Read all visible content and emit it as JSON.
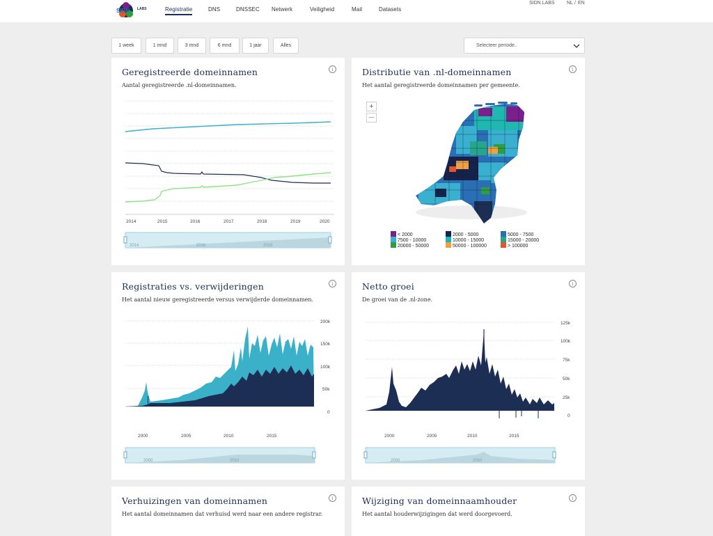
{
  "header": {
    "logo_text": "SIDN",
    "logo_sub": "LABS",
    "nav": [
      "Registratie",
      "DNS",
      "DNSSEC",
      "Netwerk",
      "Veiligheid",
      "Mail",
      "Datasets"
    ],
    "active_nav": "Registratie",
    "org_link": "SIDN LABS",
    "lang_nl": "NL",
    "lang_sep": "/",
    "lang_en": "EN"
  },
  "period_buttons": [
    "1 week",
    "1 mnd",
    "3 mnd",
    "6 mnd",
    "1 jaar",
    "Alles"
  ],
  "period_select": {
    "placeholder": "Selecteer periode.."
  },
  "colors": {
    "navy": "#1c2e54",
    "teal": "#3bb0c9",
    "green": "#8ee28a",
    "light_blue": "#bfe3ef"
  },
  "cards": {
    "registered": {
      "title": "Geregistreerde domeinnamen",
      "subtitle": "Aantal geregistreerde .nl-domeinnamen.",
      "x_ticks": [
        "2014",
        "2015",
        "2016",
        "2017",
        "2018",
        "2019",
        "2020"
      ],
      "navigator_ticks": [
        "2014",
        "2016",
        "2018"
      ]
    },
    "distribution": {
      "title": "Distributie van .nl-domeinnamen",
      "subtitle": "Het aantal geregistreerde domeinnamen per gemeente.",
      "zoom_in": "+",
      "zoom_out": "—",
      "legend": [
        {
          "label": "< 2000",
          "color": "#7a1f8c"
        },
        {
          "label": "2000 - 5000",
          "color": "#17224a"
        },
        {
          "label": "5000 - 7500",
          "color": "#2a6fb3"
        },
        {
          "label": "7500 - 10000",
          "color": "#3ab0d0"
        },
        {
          "label": "10000 - 15000",
          "color": "#1fb7b0"
        },
        {
          "label": "15000 - 20000",
          "color": "#26a68a"
        },
        {
          "label": "20000 - 50000",
          "color": "#2e9e3e"
        },
        {
          "label": "50000 - 100000",
          "color": "#f0a040"
        },
        {
          "label": "> 100000",
          "color": "#e0582a"
        }
      ]
    },
    "regs_vs_dels": {
      "title": "Registraties vs. verwijderingen",
      "subtitle": "Het aantal nieuw geregistreerde versus verwijderde domeinnamen.",
      "y_ticks": [
        "200k",
        "150k",
        "100k",
        "50k",
        "0"
      ],
      "x_ticks": [
        "2000",
        "2005",
        "2010",
        "2015"
      ],
      "navigator_ticks": [
        "2000",
        "2010"
      ]
    },
    "net_growth": {
      "title": "Netto groei",
      "subtitle": "De groei van de .nl-zone.",
      "y_ticks": [
        "125k",
        "100k",
        "75k",
        "50k",
        "25k",
        "0"
      ],
      "x_ticks": [
        "2000",
        "2005",
        "2010",
        "2015"
      ],
      "navigator_ticks": [
        "2000",
        "2010"
      ]
    },
    "moves": {
      "title": "Verhuizingen van domeinnamen",
      "subtitle": "Het aantal domeinnamen dat verhuisd werd naar een andere registrar."
    },
    "holder_changes": {
      "title": "Wijziging van domeinnaamhouder",
      "subtitle": "Het aantal houderwijzigingen dat werd doorgevoerd."
    }
  }
}
